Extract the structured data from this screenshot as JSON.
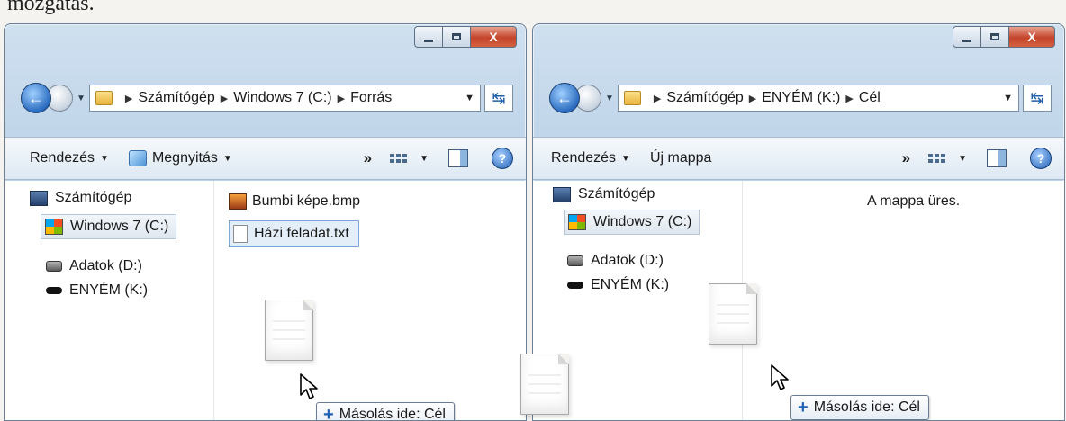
{
  "page_caption": "mozgatás.",
  "left_window": {
    "caption": {
      "minimize": "",
      "maximize": "",
      "close": "X"
    },
    "address": {
      "crumbs": [
        "Számítógép",
        "Windows 7 (C:)",
        "Forrás"
      ]
    },
    "toolbar": {
      "organize": "Rendezés",
      "open": "Megnyitás",
      "more": "»",
      "help": "?"
    },
    "nav": {
      "computer": "Számítógép",
      "drive_c": "Windows 7 (C:)",
      "drive_d": "Adatok (D:)",
      "drive_k": "ENYÉM (K:)"
    },
    "files": [
      {
        "name": "Bumbi képe.bmp",
        "icon": "bitmap-image-icon"
      },
      {
        "name": "Házi feladat.txt",
        "icon": "text-document-icon",
        "selected": true
      }
    ],
    "drag_tip": "Másolás ide: Cél"
  },
  "right_window": {
    "caption": {
      "minimize": "",
      "maximize": "",
      "close": "X"
    },
    "address": {
      "crumbs": [
        "Számítógép",
        "ENYÉM (K:)",
        "Cél"
      ]
    },
    "toolbar": {
      "organize": "Rendezés",
      "new_folder": "Új mappa",
      "more": "»",
      "help": "?"
    },
    "nav": {
      "computer": "Számítógép",
      "drive_c": "Windows 7 (C:)",
      "drive_d": "Adatok (D:)",
      "drive_k": "ENYÉM (K:)"
    },
    "empty_message": "A mappa üres.",
    "drag_tip": "Másolás ide: Cél"
  },
  "colors": {
    "window_frame": "#bcd2e8",
    "close_button": "#c3442a",
    "selection": "#e3eef9",
    "accent_blue": "#1f5fb5"
  }
}
